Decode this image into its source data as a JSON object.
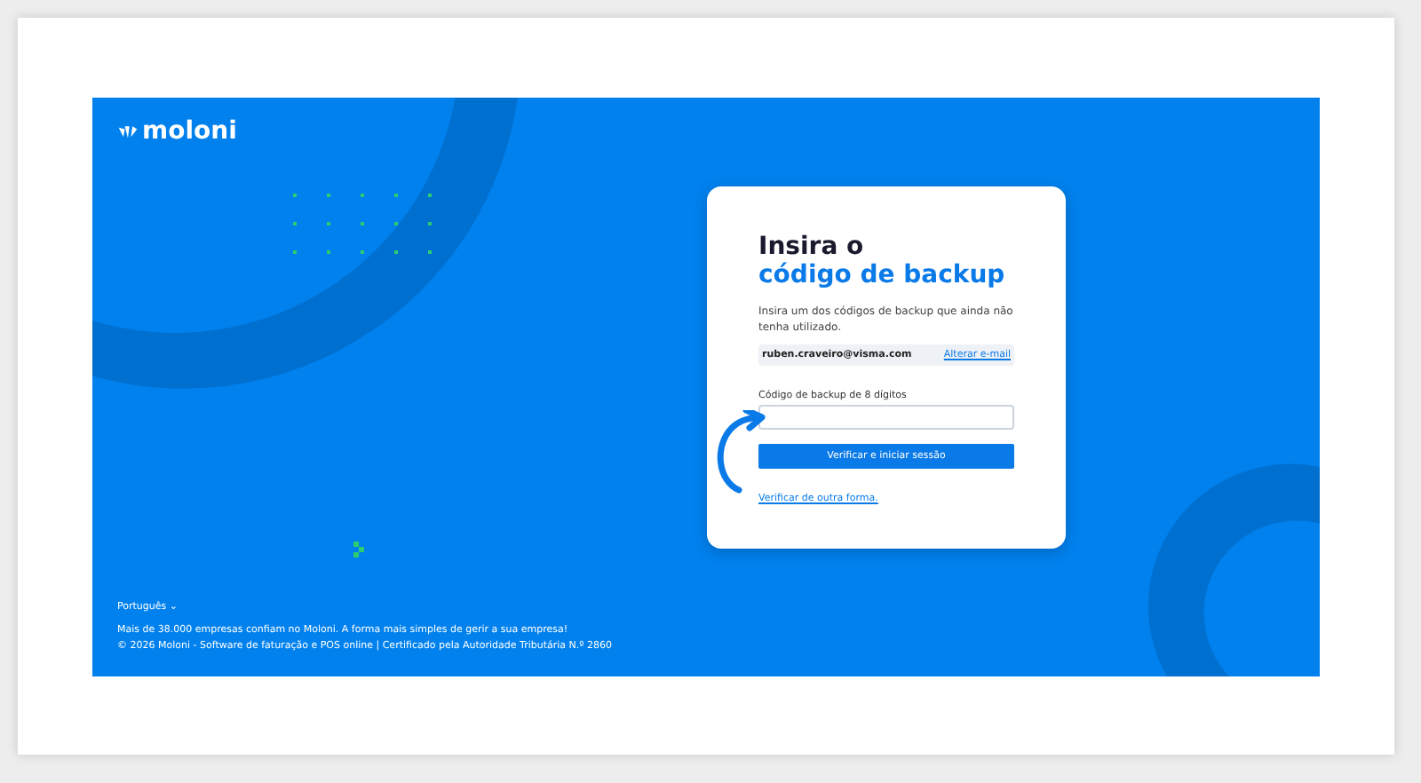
{
  "brand": {
    "name": "moloni"
  },
  "card": {
    "title_line1": "Insira o",
    "title_line2": "código de backup",
    "description": "Insira um dos códigos de backup que ainda não tenha utilizado.",
    "email": "ruben.craveiro@visma.com",
    "change_email_link": "Alterar e-mail",
    "field_label": "Código de backup de 8 dígitos",
    "submit_button": "Verificar e iniciar sessão",
    "alt_link": "Verificar de outra forma."
  },
  "footer": {
    "language": "Português",
    "caret": "⌄",
    "tagline": "Mais de 38.000 empresas confiam no Moloni. A forma mais simples de gerir a sua empresa!",
    "copyright": "© 2026 Moloni - Software de faturação e POS online | Certificado pela Autoridade Tributária N.º 2860"
  }
}
